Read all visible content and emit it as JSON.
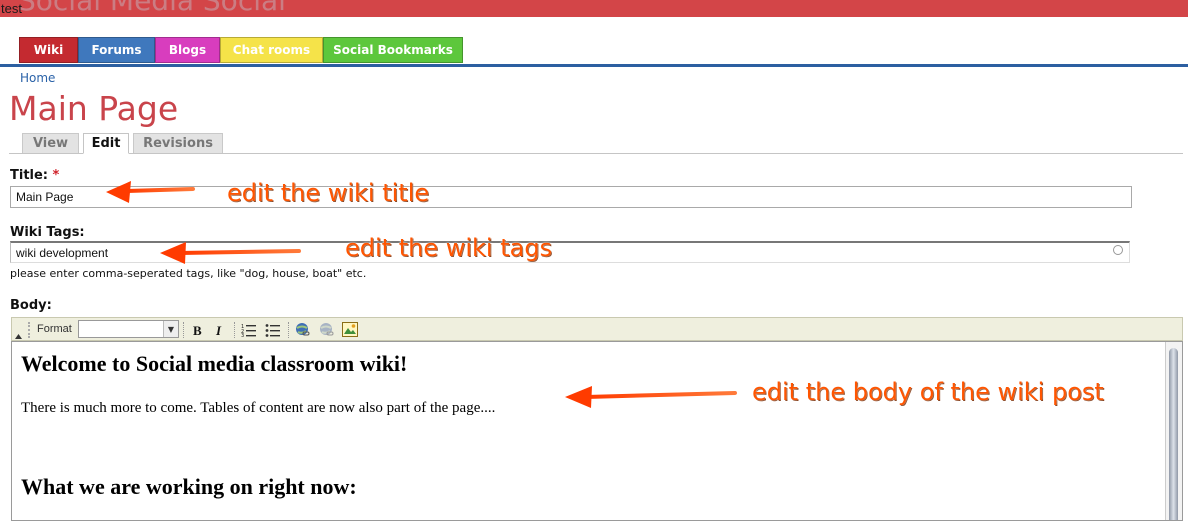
{
  "topbar": {
    "site_name": "Social Media Social",
    "test_label": "test"
  },
  "nav": {
    "tabs": [
      {
        "label": "Wiki",
        "color": "#c42a30"
      },
      {
        "label": "Forums",
        "color": "#3f78bd"
      },
      {
        "label": "Blogs",
        "color": "#d83dbe"
      },
      {
        "label": "Chat rooms",
        "color": "#f5e349"
      },
      {
        "label": "Social Bookmarks",
        "color": "#5dc73c"
      }
    ]
  },
  "breadcrumb": {
    "home": "Home"
  },
  "page": {
    "title": "Main Page"
  },
  "tabs": {
    "view": "View",
    "edit": "Edit",
    "revisions": "Revisions"
  },
  "form": {
    "title_label": "Title:",
    "required_mark": "*",
    "title_value": "Main Page",
    "tags_label": "Wiki Tags:",
    "tags_value": "wiki development",
    "tags_hint": "please enter comma-seperated tags, like \"dog, house, boat\" etc.",
    "body_label": "Body:"
  },
  "toolbar": {
    "format_label": "Format",
    "format_value": "",
    "icons": [
      "bold-icon",
      "italic-icon",
      "numbered-list-icon",
      "bullet-list-icon",
      "link-icon",
      "unlink-icon",
      "image-icon"
    ]
  },
  "editor": {
    "heading1": "Welcome to Social media classroom wiki!",
    "paragraph1": "There is much more to come. Tables of content are now also part of the page....",
    "heading2": "What we are working on right now:"
  },
  "annotations": {
    "title_note": "edit the wiki title",
    "tags_note": "edit the wiki tags",
    "body_note": "edit the body of the wiki post",
    "color": "#ff5500"
  }
}
